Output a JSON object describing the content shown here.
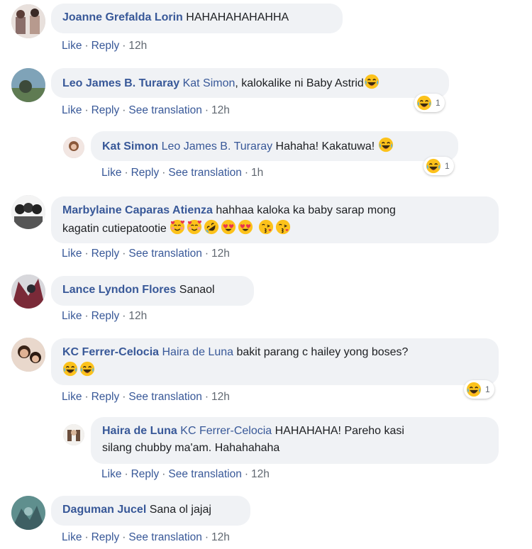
{
  "comments": [
    {
      "author": "Joanne Grefalda Lorin",
      "tag": "",
      "text": "HAHAHAHAHAHHA",
      "actions": [
        "Like",
        "Reply"
      ],
      "time": "12h",
      "reaction_count": ""
    },
    {
      "author": "Leo James B. Turaray",
      "tag": "Kat Simon",
      "text": ", kalokalike ni Baby Astrid",
      "actions": [
        "Like",
        "Reply",
        "See translation"
      ],
      "time": "12h",
      "reaction_count": "1"
    },
    {
      "author": "Kat Simon",
      "tag": "Leo James B. Turaray",
      "text": "Hahaha! Kakatuwa!",
      "actions": [
        "Like",
        "Reply",
        "See translation"
      ],
      "time": "1h",
      "reaction_count": "1"
    },
    {
      "author": "Marbylaine Caparas Atienza",
      "tag": "",
      "text": "hahhaa kaloka ka baby sarap mong",
      "text2": "kagatin cutiepatootie",
      "actions": [
        "Like",
        "Reply",
        "See translation"
      ],
      "time": "12h",
      "reaction_count": ""
    },
    {
      "author": "Lance Lyndon Flores",
      "tag": "",
      "text": "Sanaol",
      "actions": [
        "Like",
        "Reply"
      ],
      "time": "12h",
      "reaction_count": ""
    },
    {
      "author": "KC Ferrer-Celocia",
      "tag": "Haira de Luna",
      "text": "bakit parang c hailey yong boses?",
      "actions": [
        "Like",
        "Reply",
        "See translation"
      ],
      "time": "12h",
      "reaction_count": "1"
    },
    {
      "author": "Haira de Luna",
      "tag": "KC Ferrer-Celocia",
      "text": "HAHAHAHA! Pareho kasi",
      "text2": "silang chubby ma'am. Hahahahaha",
      "actions": [
        "Like",
        "Reply",
        "See translation"
      ],
      "time": "12h",
      "reaction_count": ""
    },
    {
      "author": "Daguman Jucel",
      "tag": "",
      "text": "Sana ol jajaj",
      "actions": [
        "Like",
        "Reply",
        "See translation"
      ],
      "time": "12h",
      "reaction_count": ""
    }
  ],
  "icons": {
    "laugh": "laughing-emoji-icon",
    "hearts": "smiling-face-with-hearts-emoji-icon",
    "rofl": "rolling-on-floor-laughing-emoji-icon",
    "heart_eyes": "heart-eyes-emoji-icon",
    "kiss": "face-blowing-kiss-emoji-icon"
  }
}
